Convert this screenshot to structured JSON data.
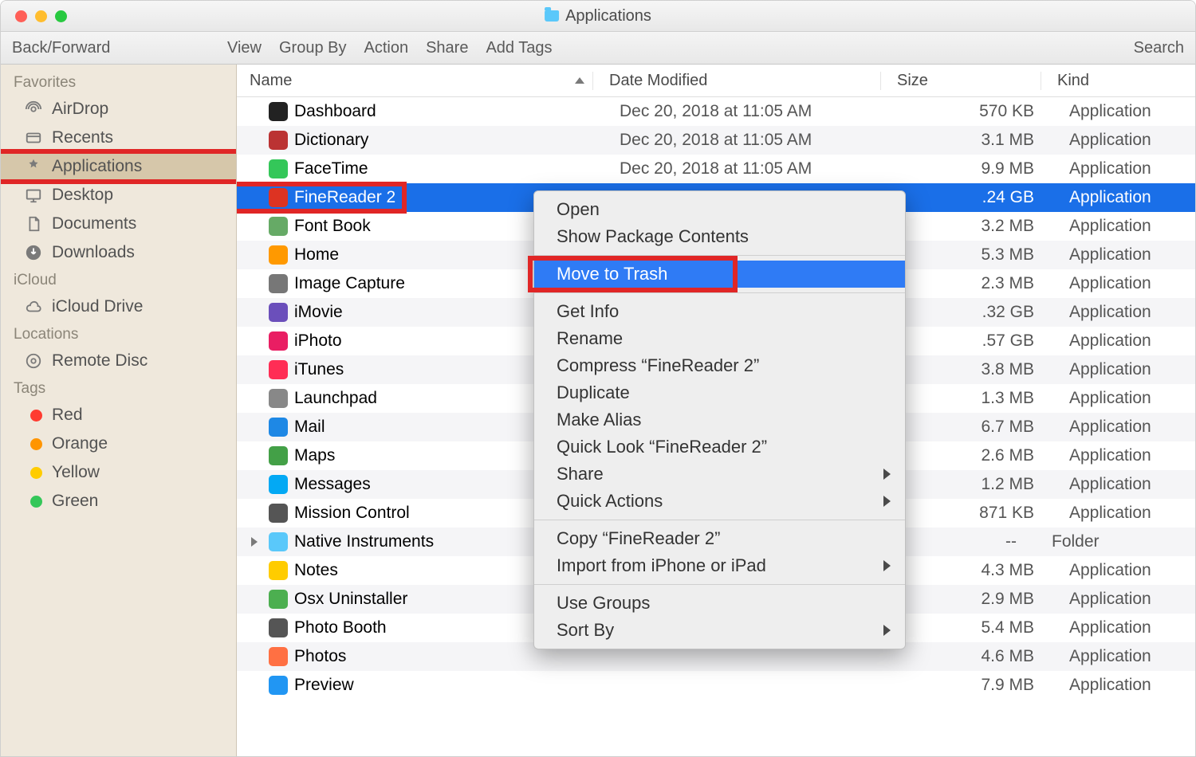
{
  "window": {
    "title": "Applications"
  },
  "toolbar": {
    "back_forward": "Back/Forward",
    "view": "View",
    "group_by": "Group By",
    "action": "Action",
    "share": "Share",
    "add_tags": "Add Tags",
    "search": "Search"
  },
  "sidebar": {
    "sections": [
      {
        "header": "Favorites",
        "items": [
          {
            "label": "AirDrop",
            "icon": "airdrop"
          },
          {
            "label": "Recents",
            "icon": "recents"
          },
          {
            "label": "Applications",
            "icon": "applications",
            "selected": true,
            "highlight": true
          },
          {
            "label": "Desktop",
            "icon": "desktop"
          },
          {
            "label": "Documents",
            "icon": "documents"
          },
          {
            "label": "Downloads",
            "icon": "downloads"
          }
        ]
      },
      {
        "header": "iCloud",
        "items": [
          {
            "label": "iCloud Drive",
            "icon": "cloud"
          }
        ]
      },
      {
        "header": "Locations",
        "items": [
          {
            "label": "Remote Disc",
            "icon": "disc"
          }
        ]
      },
      {
        "header": "Tags",
        "items": [
          {
            "label": "Red",
            "tag": "#ff3b30"
          },
          {
            "label": "Orange",
            "tag": "#ff9500"
          },
          {
            "label": "Yellow",
            "tag": "#ffcc00"
          },
          {
            "label": "Green",
            "tag": "#34c759"
          }
        ]
      }
    ]
  },
  "columns": {
    "name": "Name",
    "date": "Date Modified",
    "size": "Size",
    "kind": "Kind"
  },
  "rows": [
    {
      "name": "Dashboard",
      "date": "Dec 20, 2018 at 11:05 AM",
      "size": "570 KB",
      "kind": "Application",
      "ic": "#222"
    },
    {
      "name": "Dictionary",
      "date": "Dec 20, 2018 at 11:05 AM",
      "size": "3.1 MB",
      "kind": "Application",
      "ic": "#b33"
    },
    {
      "name": "FaceTime",
      "date": "Dec 20, 2018 at 11:05 AM",
      "size": "9.9 MB",
      "kind": "Application",
      "ic": "#34c759"
    },
    {
      "name": "FineReader 2",
      "date": "",
      "size": ".24 GB",
      "kind": "Application",
      "selected": true,
      "highlight": true,
      "ic": "#d32"
    },
    {
      "name": "Font Book",
      "date": "",
      "size": "3.2 MB",
      "kind": "Application",
      "ic": "#6a6"
    },
    {
      "name": "Home",
      "date": "",
      "size": "5.3 MB",
      "kind": "Application",
      "ic": "#f90"
    },
    {
      "name": "Image Capture",
      "date": "",
      "size": "2.3 MB",
      "kind": "Application",
      "ic": "#777"
    },
    {
      "name": "iMovie",
      "date": "",
      "size": ".32 GB",
      "kind": "Application",
      "ic": "#6b4fbb"
    },
    {
      "name": "iPhoto",
      "date": "",
      "size": ".57 GB",
      "kind": "Application",
      "ic": "#e91e63"
    },
    {
      "name": "iTunes",
      "date": "",
      "size": "3.8 MB",
      "kind": "Application",
      "ic": "#ff2d55"
    },
    {
      "name": "Launchpad",
      "date": "",
      "size": "1.3 MB",
      "kind": "Application",
      "ic": "#888"
    },
    {
      "name": "Mail",
      "date": "",
      "size": "6.7 MB",
      "kind": "Application",
      "ic": "#1e88e5"
    },
    {
      "name": "Maps",
      "date": "",
      "size": "2.6 MB",
      "kind": "Application",
      "ic": "#43a047"
    },
    {
      "name": "Messages",
      "date": "",
      "size": "1.2 MB",
      "kind": "Application",
      "ic": "#03a9f4"
    },
    {
      "name": "Mission Control",
      "date": "",
      "size": "871 KB",
      "kind": "Application",
      "ic": "#555"
    },
    {
      "name": "Native Instruments",
      "date": "",
      "size": "--",
      "kind": "Folder",
      "folder": true,
      "ic": "#5ac8fa"
    },
    {
      "name": "Notes",
      "date": "",
      "size": "4.3 MB",
      "kind": "Application",
      "ic": "#fc0"
    },
    {
      "name": "Osx Uninstaller",
      "date": "",
      "size": "2.9 MB",
      "kind": "Application",
      "ic": "#4caf50"
    },
    {
      "name": "Photo Booth",
      "date": "",
      "size": "5.4 MB",
      "kind": "Application",
      "ic": "#555"
    },
    {
      "name": "Photos",
      "date": "",
      "size": "4.6 MB",
      "kind": "Application",
      "ic": "#ff7043"
    },
    {
      "name": "Preview",
      "date": "",
      "size": "7.9 MB",
      "kind": "Application",
      "ic": "#2196f3"
    }
  ],
  "context_menu": {
    "groups": [
      [
        {
          "label": "Open"
        },
        {
          "label": "Show Package Contents"
        }
      ],
      [
        {
          "label": "Move to Trash",
          "highlight": true,
          "boxed": true
        }
      ],
      [
        {
          "label": "Get Info"
        },
        {
          "label": "Rename"
        },
        {
          "label": "Compress “FineReader 2”"
        },
        {
          "label": "Duplicate"
        },
        {
          "label": "Make Alias"
        },
        {
          "label": "Quick Look “FineReader 2”"
        },
        {
          "label": "Share",
          "sub": true
        },
        {
          "label": "Quick Actions",
          "sub": true
        }
      ],
      [
        {
          "label": "Copy “FineReader 2”"
        },
        {
          "label": "Import from iPhone or iPad",
          "sub": true
        }
      ],
      [
        {
          "label": "Use Groups"
        },
        {
          "label": "Sort By",
          "sub": true
        }
      ]
    ]
  }
}
